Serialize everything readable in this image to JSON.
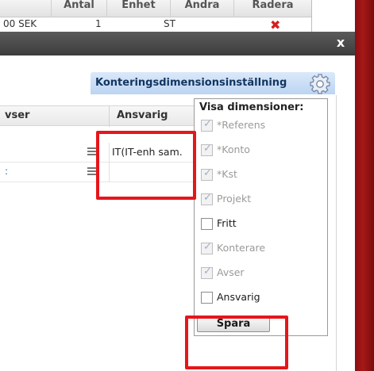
{
  "background_table": {
    "columns": [
      "Antal",
      "Enhet",
      "Ändra",
      "Radera"
    ],
    "row": {
      "amount": "00 SEK",
      "quantity": "1",
      "unit": "ST"
    }
  },
  "dialog": {
    "close_label": "x",
    "settings_title": "Konteringsdimensionsinställning",
    "table": {
      "headers": {
        "edge": "vser",
        "ansvarig": "Ansvarig"
      },
      "rows": [
        {
          "edge": "",
          "ansvarig": "IT(IT-enh sam."
        },
        {
          "edge": ":",
          "ansvarig": ""
        }
      ]
    },
    "dimension_panel": {
      "heading": "Visa dimensioner:",
      "items": [
        {
          "label": "*Referens",
          "checked": true,
          "disabled": true
        },
        {
          "label": "*Konto",
          "checked": true,
          "disabled": true
        },
        {
          "label": "*Kst",
          "checked": true,
          "disabled": true
        },
        {
          "label": "Projekt",
          "checked": true,
          "disabled": true
        },
        {
          "label": "Fritt",
          "checked": false,
          "disabled": false
        },
        {
          "label": "Konterare",
          "checked": true,
          "disabled": true
        },
        {
          "label": "Avser",
          "checked": true,
          "disabled": true
        },
        {
          "label": "Ansvarig",
          "checked": false,
          "disabled": false
        }
      ],
      "save_label": "Spara"
    }
  },
  "colors": {
    "titlebar": "#4a4a4a",
    "settings_header": "#c9dcf5",
    "highlight": "#e5161b",
    "side_edge": "#9b1414",
    "delete_icon": "#d42020"
  }
}
